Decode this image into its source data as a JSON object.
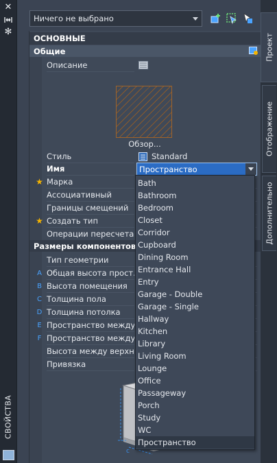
{
  "palette": {
    "title": "СВОЙСТВА",
    "tabs": [
      "Проект",
      "Отображение",
      "Дополнительно"
    ]
  },
  "toolbar": {
    "selection": "Ничего не выбрано",
    "icons": [
      "quick-select-icon",
      "select-objects-icon",
      "toggle-pickadd-icon"
    ]
  },
  "grid": {
    "category_main": "ОСНОВНЫЕ",
    "subcategory_general": "Общие",
    "rows_general": [
      {
        "label": "Описание",
        "value": "",
        "icon": "description-edit-icon"
      },
      {
        "label": "Стиль",
        "value": "Standard",
        "icon": "style-icon"
      },
      {
        "label": "Имя",
        "value": "Пространство"
      },
      {
        "label": "Марка",
        "marker": "★"
      },
      {
        "label": "Ассоциативный"
      },
      {
        "label": "Границы смещений"
      },
      {
        "label": "Создать тип",
        "marker": "★"
      },
      {
        "label": "Операции пересчета"
      }
    ],
    "browse_label": "Обзор...",
    "category_dims": "Размеры компонентов",
    "rows_dims": [
      {
        "key": "",
        "label": "Тип геометрии"
      },
      {
        "key": "A",
        "label": "Общая высота прост..."
      },
      {
        "key": "B",
        "label": "Высота помещения"
      },
      {
        "key": "C",
        "label": "Толщина пола"
      },
      {
        "key": "D",
        "label": "Толщина потолка"
      },
      {
        "key": "E",
        "label": "Пространство между..."
      },
      {
        "key": "F",
        "label": "Пространство между..."
      },
      {
        "key": "",
        "label": "Высота между верхн..."
      },
      {
        "key": "",
        "label": "Привязка"
      }
    ]
  },
  "dropdown": {
    "options": [
      "Bath",
      "Bathroom",
      "Bedroom",
      "Closet",
      "Corridor",
      "Cupboard",
      "Dining Room",
      "Entrance Hall",
      "Entry",
      "Garage - Double",
      "Garage - Single",
      "Hallway",
      "Kitchen",
      "Library",
      "Living Room",
      "Lounge",
      "Office",
      "Passageway",
      "Porch",
      "Study",
      "WC",
      "Пространство"
    ],
    "selected": "Пространство"
  },
  "colors": {
    "panel_bg": "#3b4453",
    "accent_blue": "#2b6cc4",
    "marker_yellow": "#f5b400",
    "key_blue": "#4aa3ff"
  }
}
